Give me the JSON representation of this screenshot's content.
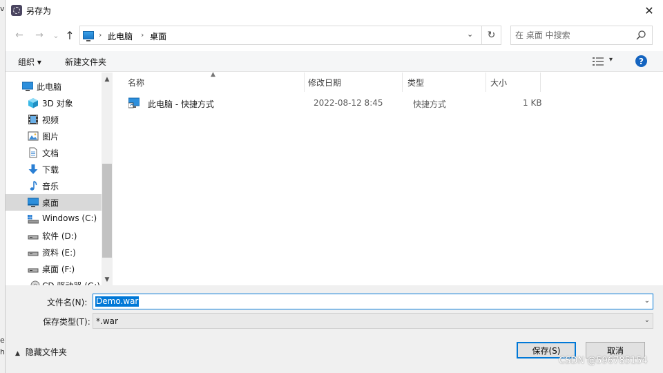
{
  "backdrop": {
    "fragments": [
      "v",
      "e",
      "h"
    ]
  },
  "titlebar": {
    "title": "另存为",
    "close": "✕"
  },
  "address": {
    "back": "←",
    "forward": "→",
    "recent": "⌄",
    "up": "↑",
    "crumbs": [
      "此电脑",
      "桌面"
    ],
    "separator": "›",
    "dropdown": "⌄",
    "refresh": "↻"
  },
  "search": {
    "placeholder": "在 桌面 中搜索"
  },
  "toolbar": {
    "organize": "组织 ▾",
    "new_folder": "新建文件夹",
    "view_dropdown": "▾",
    "help": "?"
  },
  "nav": {
    "items": [
      {
        "label": "此电脑",
        "icon": "pc-icon"
      },
      {
        "label": "3D 对象",
        "icon": "cube-icon"
      },
      {
        "label": "视频",
        "icon": "video-icon"
      },
      {
        "label": "图片",
        "icon": "picture-icon"
      },
      {
        "label": "文档",
        "icon": "document-icon"
      },
      {
        "label": "下载",
        "icon": "download-icon"
      },
      {
        "label": "音乐",
        "icon": "music-icon"
      },
      {
        "label": "桌面",
        "icon": "desktop-icon",
        "selected": true
      },
      {
        "label": "Windows (C:)",
        "icon": "system-drive-icon"
      },
      {
        "label": "软件 (D:)",
        "icon": "drive-icon"
      },
      {
        "label": "资料 (E:)",
        "icon": "drive-icon"
      },
      {
        "label": "桌面 (F:)",
        "icon": "drive-icon"
      },
      {
        "label": "CD 驱动器 (G:)",
        "icon": "cd-drive-icon"
      }
    ],
    "scroll_up": "▲",
    "scroll_down": "▼"
  },
  "filelist": {
    "columns": [
      "名称",
      "修改日期",
      "类型",
      "大小"
    ],
    "sort_indicator": "▲",
    "rows": [
      {
        "name": "此电脑 - 快捷方式",
        "modified": "2022-08-12 8:45",
        "type": "快捷方式",
        "size": "1 KB"
      }
    ]
  },
  "bottom": {
    "filename_label": "文件名(N):",
    "filename_value": "Demo.war",
    "filetype_label": "保存类型(T):",
    "filetype_value": "*.war",
    "dropdown": "⌄",
    "hide_folders": "隐藏文件夹",
    "hide_chevron": "▲",
    "save": "保存(S)",
    "cancel": "取消",
    "watermark": "CSDN @596785154"
  },
  "colors": {
    "accent": "#0078d7",
    "selected_nav": "#d9d9d9",
    "help_blue": "#1464c0"
  }
}
